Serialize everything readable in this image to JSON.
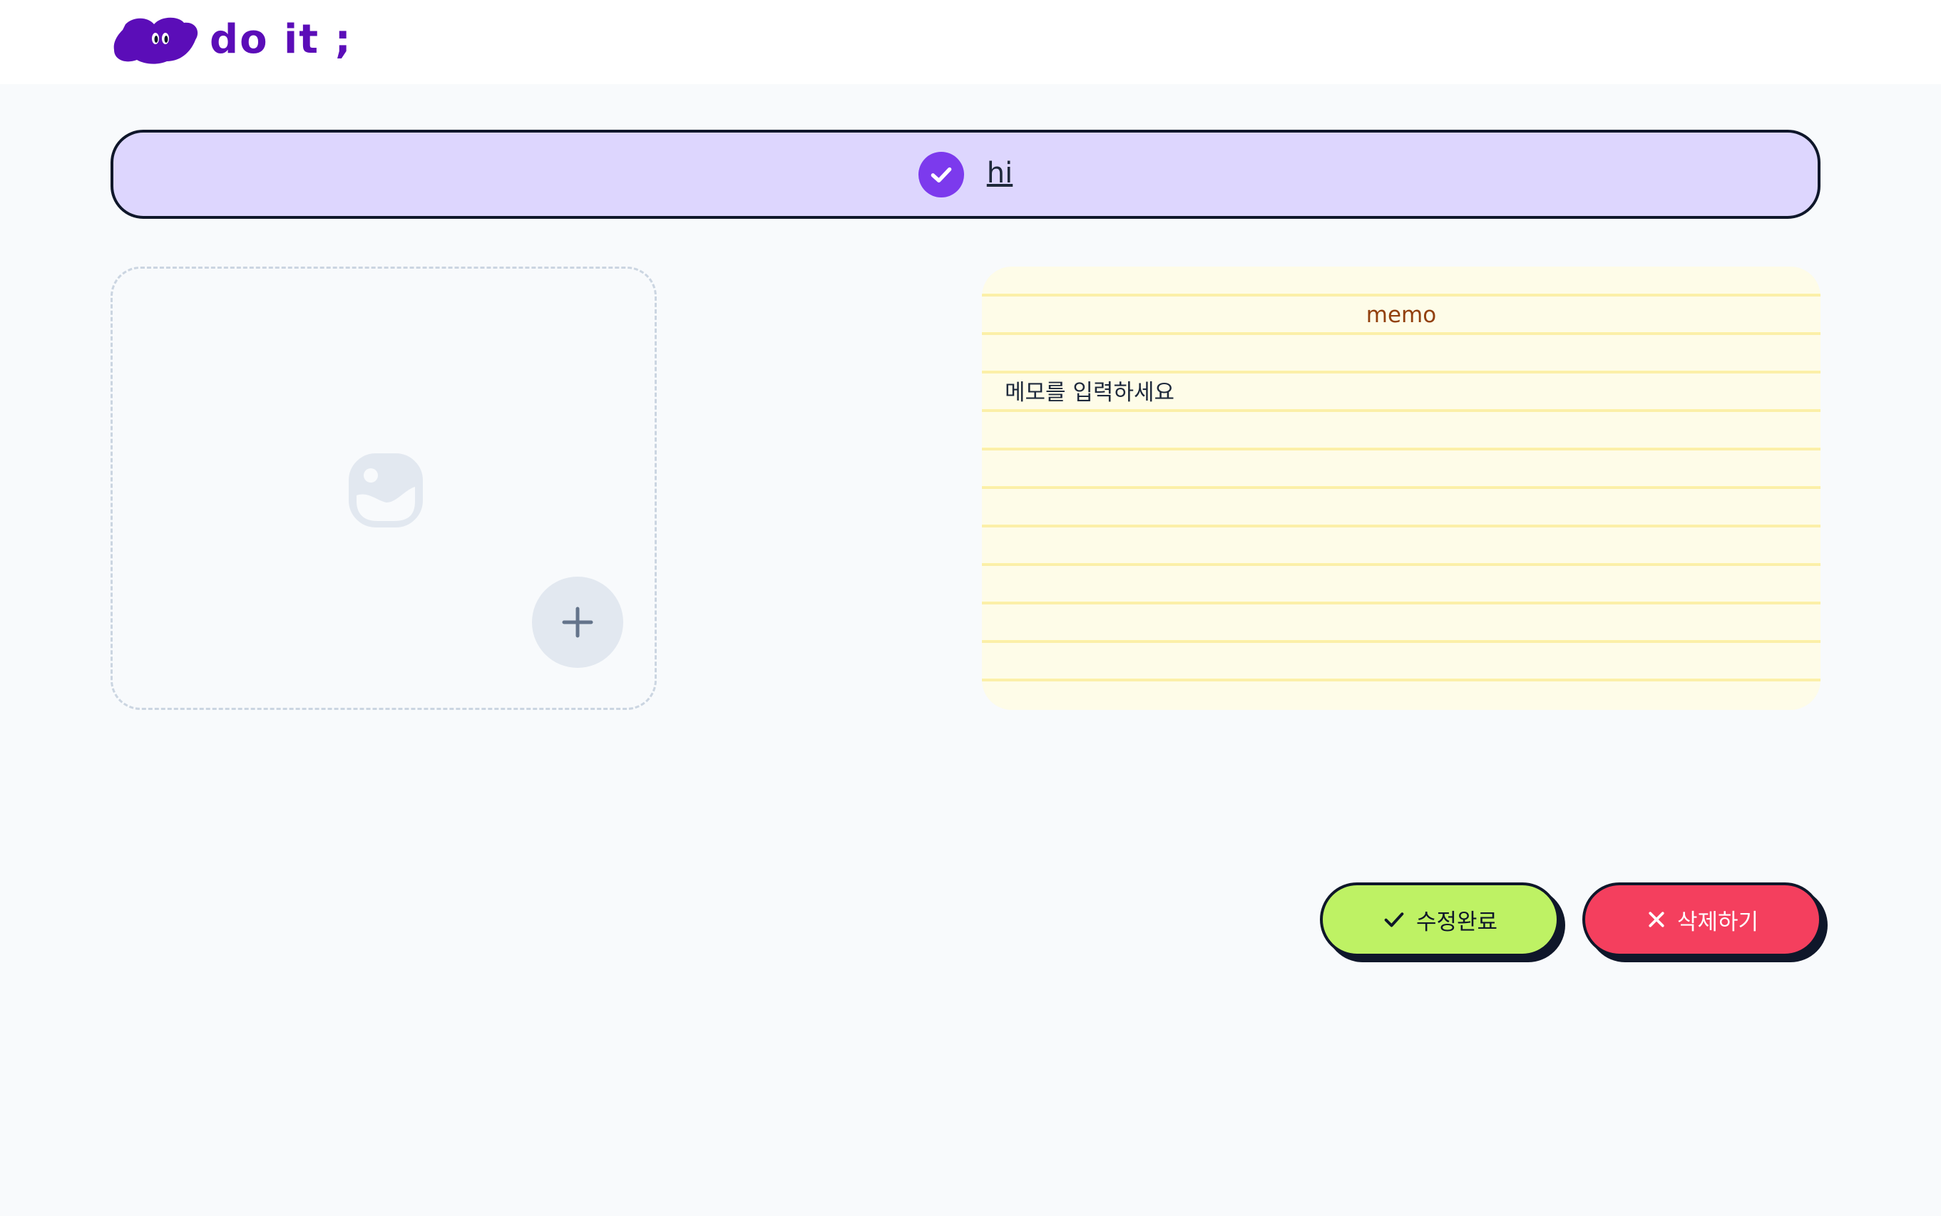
{
  "header": {
    "logo_text": "do it ;",
    "logo_icon": "cloud-mascot-icon"
  },
  "todo": {
    "title": "hi",
    "completed": true,
    "check_icon": "check-circle-icon"
  },
  "image": {
    "placeholder_icon": "image-placeholder-icon",
    "add_icon": "plus-icon"
  },
  "memo": {
    "label": "memo",
    "placeholder": "메모를 입력하세요",
    "value": ""
  },
  "actions": {
    "save_label": "수정완료",
    "save_icon": "check-icon",
    "delete_label": "삭제하기",
    "delete_icon": "x-icon"
  },
  "colors": {
    "brand": "#5B0DB8",
    "title_bg": "#DDD6FE",
    "check": "#7C3AED",
    "memo_bg": "#FEFCE8",
    "memo_label": "#92400E",
    "save_bg": "#BEF264",
    "delete_bg": "#F43F5E"
  }
}
